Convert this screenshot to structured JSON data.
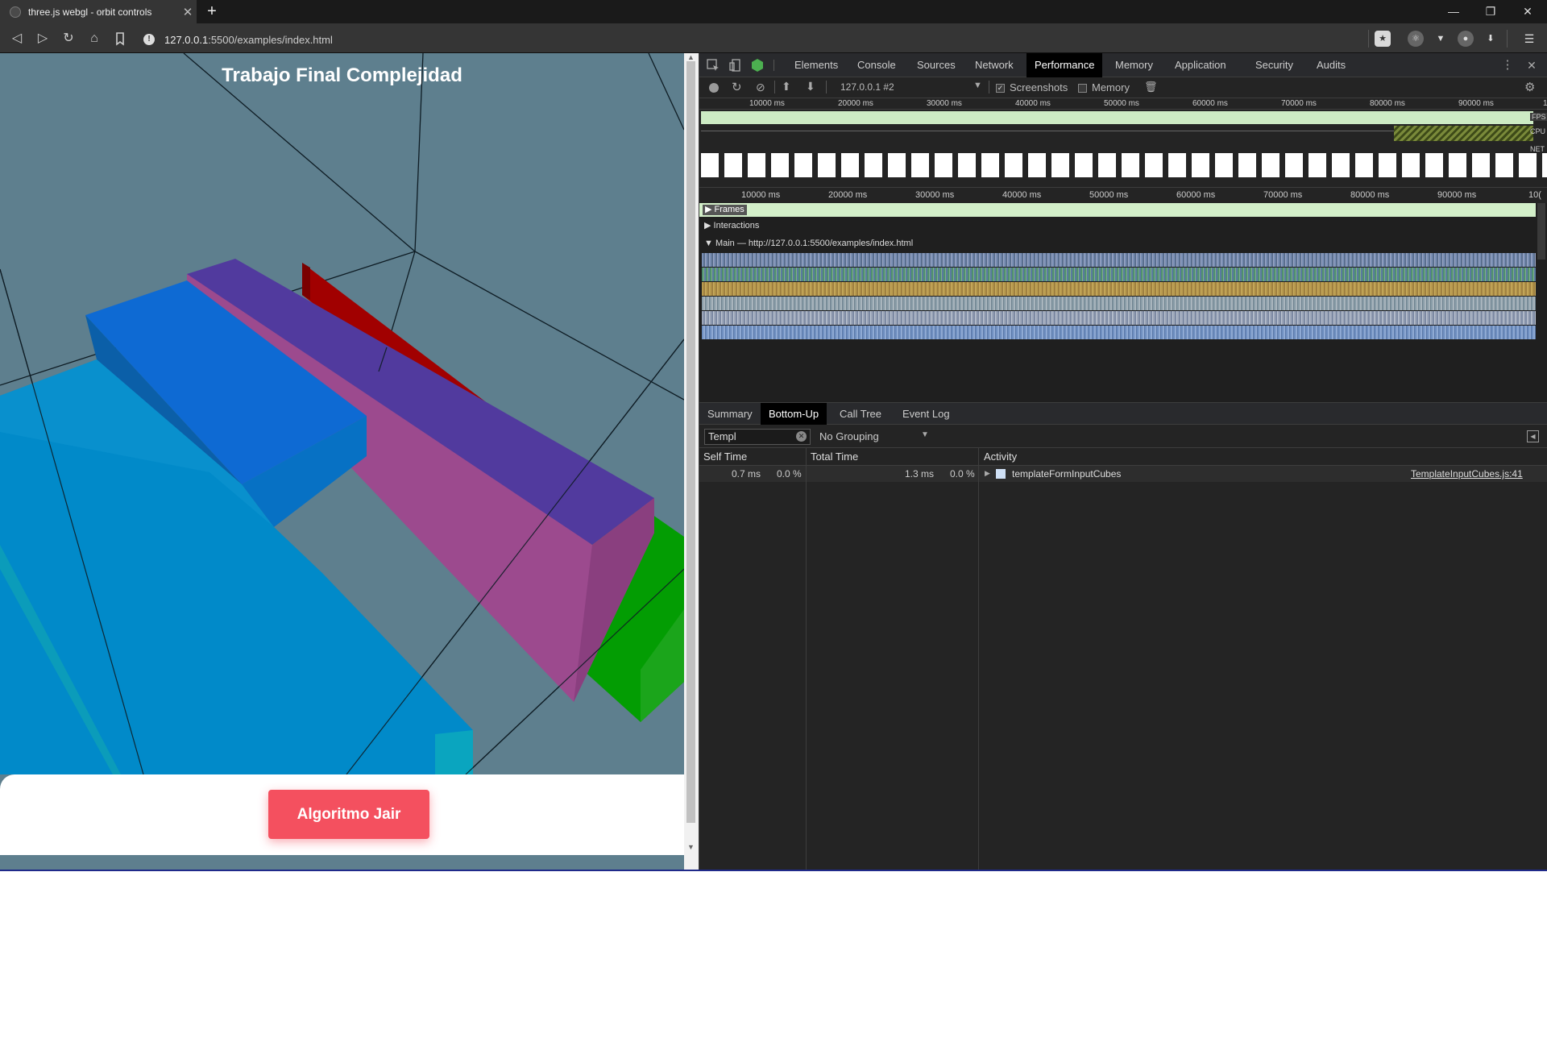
{
  "browser": {
    "tab_title": "three.js webgl - orbit controls",
    "new_tab": "+",
    "url_host": "127.0.0.1",
    "url_path": ":5500/examples/index.html"
  },
  "scene": {
    "title": "Trabajo Final Complejidad",
    "button_label": "Algoritmo Jair"
  },
  "devtools": {
    "tabs": [
      "Elements",
      "Console",
      "Sources",
      "Network",
      "Performance",
      "Memory",
      "Application",
      "Security",
      "Audits"
    ],
    "active_tab": "Performance",
    "toolbar": {
      "profile": "127.0.0.1 #2",
      "screenshots": "Screenshots",
      "memory": "Memory"
    },
    "timeline_ticks_top": [
      "10000 ms",
      "20000 ms",
      "30000 ms",
      "40000 ms",
      "50000 ms",
      "60000 ms",
      "70000 ms",
      "80000 ms",
      "90000 ms",
      "1"
    ],
    "timeline_ticks_main": [
      "10000 ms",
      "20000 ms",
      "30000 ms",
      "40000 ms",
      "50000 ms",
      "60000 ms",
      "70000 ms",
      "80000 ms",
      "90000 ms",
      "10("
    ],
    "lane_labels": {
      "fps": "FPS",
      "cpu": "CPU",
      "net": "NET"
    },
    "tracks": {
      "frames": "Frames",
      "interactions": "Interactions",
      "main": "Main — http://127.0.0.1:5500/examples/index.html"
    },
    "bottom_tabs": [
      "Summary",
      "Bottom-Up",
      "Call Tree",
      "Event Log"
    ],
    "active_bottom_tab": "Bottom-Up",
    "filter_value": "Templ",
    "grouping": "No Grouping",
    "columns": {
      "self_time": "Self Time",
      "total_time": "Total Time",
      "activity": "Activity"
    },
    "rows": [
      {
        "self_ms": "0.7 ms",
        "self_pct": "0.0 %",
        "total_ms": "1.3 ms",
        "total_pct": "0.0 %",
        "activity": "templateFormInputCubes",
        "source": "TemplateInputCubes.js:41"
      }
    ]
  }
}
